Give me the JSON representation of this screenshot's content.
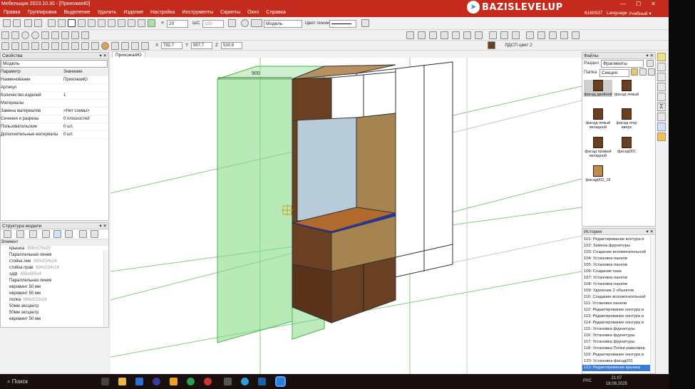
{
  "window": {
    "title": "Мебельщик 2023.10.30 - [ПрихожаяЮ]",
    "brand": "BAZISLEVELUP",
    "license": "6160537",
    "language": "Language",
    "mode": "Учебный ▾"
  },
  "menu": [
    "Правка",
    "Группировка",
    "Выделение",
    "Удалить",
    "Изделие",
    "Настройка",
    "Инструменты",
    "Скрипты",
    "Окно",
    "Справка"
  ],
  "toolbar": {
    "line_width": "20",
    "step_label": "ШС",
    "step_value": "100",
    "layer": "Модель",
    "line_color_label": "Цвет линии",
    "material": "ЛДСП цвет 2"
  },
  "coords": {
    "x_label": "X",
    "x": "792,7",
    "y_label": "Y",
    "y": "957,7",
    "z_label": "Z",
    "z": "510,9"
  },
  "properties": {
    "title": "Свойства",
    "object": "Модель",
    "col_param": "Параметр",
    "col_value": "Значение",
    "rows": [
      {
        "k": "Наименование",
        "v": "ПрихожаяЮ"
      },
      {
        "k": "Артикул",
        "v": ""
      },
      {
        "k": "Количество изделий",
        "v": "1"
      },
      {
        "k": "Материалы",
        "v": ""
      },
      {
        "k": "Замена материалов",
        "v": "<Нет схемы>"
      },
      {
        "k": "Сечения и разрезы",
        "v": "0 плоскостей"
      },
      {
        "k": "Пользовательские",
        "v": "0 шт."
      },
      {
        "k": "Дополнительные материалы",
        "v": "0 шт."
      }
    ]
  },
  "structure": {
    "title": "Структура модели",
    "col": "Элемент",
    "items": [
      {
        "name": "крышка",
        "dim": "900x570x25"
      },
      {
        "name": "Параллельная линия",
        "dim": ""
      },
      {
        "name": "стойка лев",
        "dim": "890x534x16"
      },
      {
        "name": "стойка прав",
        "dim": "890x534x16"
      },
      {
        "name": "хдф",
        "dim": "895x895x4"
      },
      {
        "name": "Параллельная линия",
        "dim": ""
      },
      {
        "name": "евровинт 50 мм",
        "dim": ""
      },
      {
        "name": "евровинт 50 мм",
        "dim": ""
      },
      {
        "name": "полка",
        "dim": "866x533x16"
      },
      {
        "name": "50мм эксцентр",
        "dim": ""
      },
      {
        "name": "50мм эксцентр",
        "dim": ""
      },
      {
        "name": "евровинт 50 мм",
        "dim": ""
      }
    ]
  },
  "document_tab": "ПрихожаяЮ",
  "viewport": {
    "dimension_label": "900"
  },
  "files": {
    "title": "Файлы",
    "section_label": "Раздел",
    "section_value": "Фрагменты",
    "folder_label": "Папка",
    "folder_value": "Секция фасад",
    "tiles": [
      {
        "label": "фасад двойной"
      },
      {
        "label": "фасад левый"
      },
      {
        "label": "фасад левый вкладной"
      },
      {
        "label": "фасад откр вверх"
      },
      {
        "label": "фасад правый вкладной"
      },
      {
        "label": "фасад001"
      },
      {
        "label": "фасад002_18"
      }
    ]
  },
  "history": {
    "title": "История",
    "items": [
      "101: Редактирование контура и",
      "102: Замена фурнитуры",
      "103: Создание вспомогательной",
      "104: Установка панели",
      "105: Установка панели",
      "106: Создание паза",
      "107: Установка панели",
      "108: Установка панели",
      "109: Удаление 2 объектов",
      "110: Создание вспомогательной",
      "111: Установка панели",
      "112: Редактирование контура и",
      "113: Редактирование контура и",
      "114: Редактирование контура и",
      "115: Установка фурнитуры",
      "116: Установка фурнитуры",
      "117: Установка фурнитуры",
      "118: Установка Полки равномер",
      "119: Редактирование контура и",
      "120: Установка фасад001",
      "121: Редактирование крышка"
    ]
  },
  "taskbar": {
    "search": "Поиск",
    "lang": "РУС",
    "time": "21:07",
    "date": "18.08.2025"
  },
  "colors": {
    "title_bar": "#c42b1c",
    "selection_green": "#6fd36f",
    "wood": "#6b3f22",
    "highlight_blue": "#1b2fd6"
  }
}
